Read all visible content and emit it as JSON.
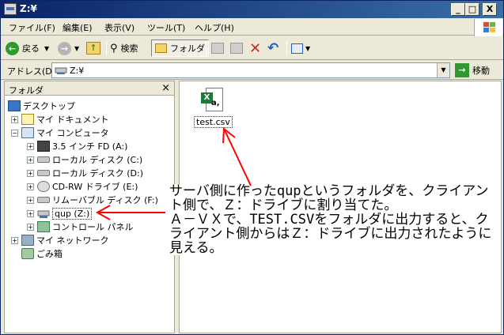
{
  "window": {
    "title": "Z:¥",
    "buttons": {
      "minimize": "_",
      "maximize": "□",
      "close": "X"
    }
  },
  "menu": [
    "ファイル(F)",
    "編集(E)",
    "表示(V)",
    "ツール(T)",
    "ヘルプ(H)"
  ],
  "toolbar": {
    "back_label": "戻る",
    "search_label": "検索",
    "folders_label": "フォルダ",
    "back_icon": "back-arrow-icon",
    "forward_icon": "forward-arrow-icon",
    "up_icon": "up-folder-icon",
    "delete_icon": "delete-x-icon",
    "undo_icon": "undo-icon",
    "views_icon": "views-icon"
  },
  "address": {
    "label": "アドレス(D)",
    "value": "Z:¥",
    "go_label": "移動"
  },
  "folder_pane": {
    "title": "フォルダ",
    "close": "×",
    "tree": [
      {
        "label": "デスクトップ",
        "icon": "desktop-icon",
        "expander": ""
      },
      {
        "label": "マイ ドキュメント",
        "icon": "my-documents-icon",
        "expander": "+"
      },
      {
        "label": "マイ コンピュータ",
        "icon": "my-computer-icon",
        "expander": "−"
      },
      {
        "label": "3.5 インチ FD (A:)",
        "icon": "floppy-drive-icon",
        "expander": "+"
      },
      {
        "label": "ローカル ディスク (C:)",
        "icon": "hard-drive-icon",
        "expander": "+"
      },
      {
        "label": "ローカル ディスク (D:)",
        "icon": "hard-drive-icon",
        "expander": "+"
      },
      {
        "label": "CD-RW ドライブ (E:)",
        "icon": "cd-drive-icon",
        "expander": "+"
      },
      {
        "label": "リムーバブル ディスク (F:)",
        "icon": "removable-disk-icon",
        "expander": "+"
      },
      {
        "label": "qup (Z:)",
        "icon": "network-drive-icon",
        "expander": "+"
      },
      {
        "label": "コントロール パネル",
        "icon": "control-panel-icon",
        "expander": "+"
      },
      {
        "label": "マイ ネットワーク",
        "icon": "my-network-icon",
        "expander": "+"
      },
      {
        "label": "ごみ箱",
        "icon": "recycle-bin-icon",
        "expander": ""
      }
    ]
  },
  "content": {
    "file_name": "test.csv",
    "file_icon": "excel-csv-icon"
  },
  "annotation": {
    "text": "サーバ側に作ったqupというフォルダを、クライアント側で、Ｚ：ドライブに割り当てた。\nＡ－ＶＸで、TEST.CSVをフォルダに出力すると、クライアント側からはＺ：ドライブに出力されたように見える。",
    "color": "#FF0000"
  }
}
